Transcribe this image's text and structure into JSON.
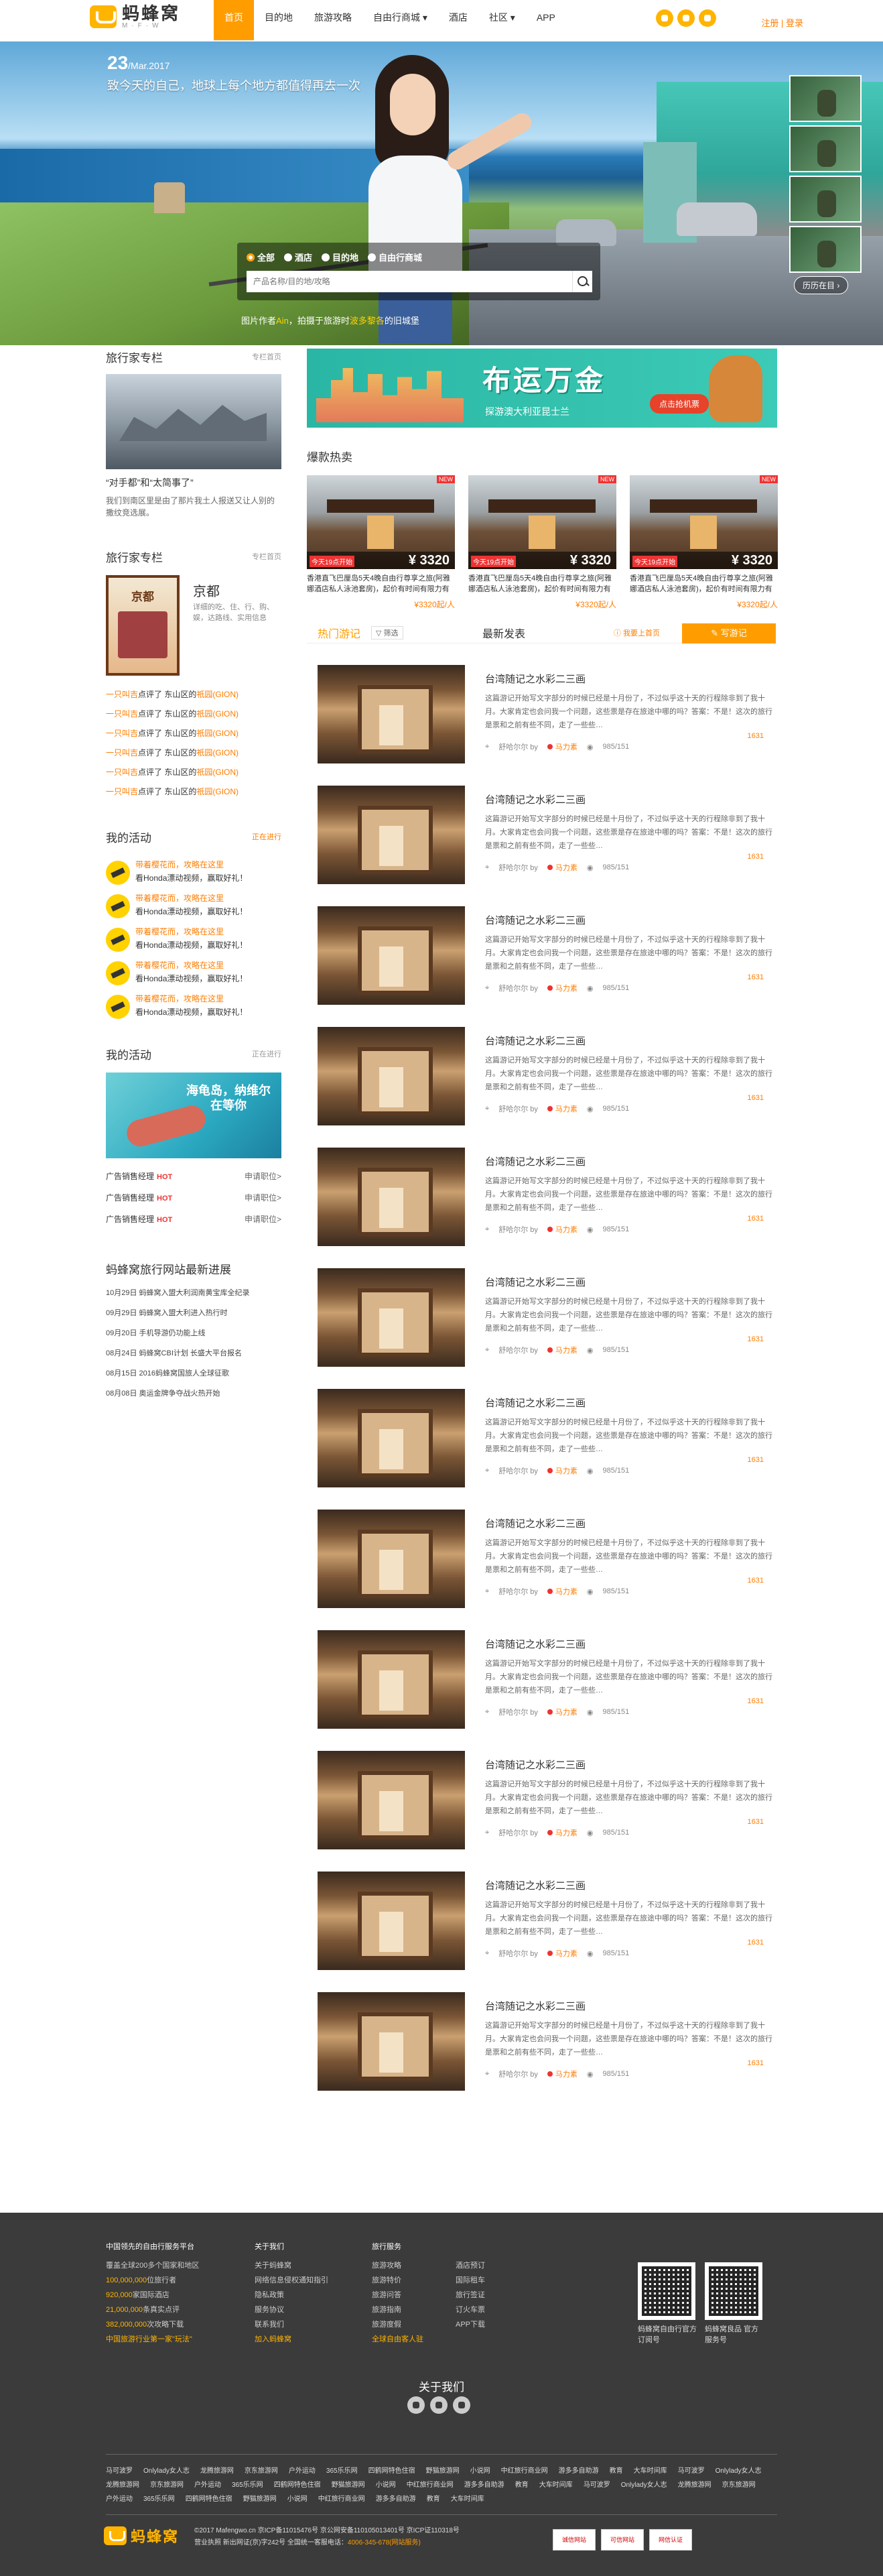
{
  "nav": {
    "logo": "蚂蜂窝",
    "logo_sub": "M·F·W",
    "items": [
      "首页",
      "目的地",
      "旅游攻略",
      "自由行商城 ▾",
      "酒店",
      "社区 ▾",
      "APP"
    ],
    "login": "注册 | 登录"
  },
  "hero": {
    "date_day": "23",
    "date_rest": "/Mar.2017",
    "tagline": "致今天的自己，地球上每个地方都值得再去一次",
    "radios": [
      "全部",
      "酒店",
      "目的地",
      "自由行商城"
    ],
    "search_placeholder": "产品名称/目的地/攻略",
    "history": "历历在目 ›",
    "caption_prefix": "图片作者",
    "caption_author": "Ain",
    "caption_mid": "，拍摄于旅游时",
    "caption_place": "波多黎各",
    "caption_suffix": "的旧城堡"
  },
  "left": {
    "column1": {
      "title": "旅行家专栏",
      "more": "专栏首页",
      "article_title": "“对手都”和“太简事了”",
      "article_text": "我们到南区里是由了那片我土人报送又让人别的撒纹竞选展。"
    },
    "column2": {
      "title": "旅行家专栏",
      "more": "专栏首页",
      "book_cover": "京都",
      "book_name": "京都",
      "book_desc": "详细的吃、住、行、购、娱，达路线、实用信息"
    },
    "feed": [
      {
        "user": "一只叫吉",
        "action": "点评了 东山区的",
        "place": "祇园(GION)"
      },
      {
        "user": "一只叫吉",
        "action": "点评了 东山区的",
        "place": "祇园(GION)"
      },
      {
        "user": "一只叫吉",
        "action": "点评了 东山区的",
        "place": "祇园(GION)"
      },
      {
        "user": "一只叫吉",
        "action": "点评了 东山区的",
        "place": "祇园(GION)"
      },
      {
        "user": "一只叫吉",
        "action": "点评了 东山区的",
        "place": "祇园(GION)"
      },
      {
        "user": "一只叫吉",
        "action": "点评了 东山区的",
        "place": "祇园(GION)"
      }
    ],
    "activities": {
      "title": "我的活动",
      "more": "正在进行",
      "items": [
        {
          "t1": "带着樱花而，攻略在这里",
          "t2": "看Honda漂动视频，赢取好礼！"
        },
        {
          "t1": "带着樱花而，攻略在这里",
          "t2": "看Honda漂动视频，赢取好礼！"
        },
        {
          "t1": "带着樱花而，攻略在这里",
          "t2": "看Honda漂动视频，赢取好礼！"
        },
        {
          "t1": "带着樱花而，攻略在这里",
          "t2": "看Honda漂动视频，赢取好礼！"
        },
        {
          "t1": "带着樱花而，攻略在这里",
          "t2": "看Honda漂动视频，赢取好礼！"
        }
      ]
    },
    "activities2": {
      "title": "我的活动",
      "more": "正在进行",
      "ad_line1": "海龟岛，纳维尔",
      "ad_line2": "在等你"
    },
    "jobs": [
      {
        "title": "广告销售经理",
        "hot": "HOT",
        "apply": "申请职位>"
      },
      {
        "title": "广告销售经理",
        "hot": "HOT",
        "apply": "申请职位>"
      },
      {
        "title": "广告销售经理",
        "hot": "HOT",
        "apply": "申请职位>"
      }
    ],
    "news": {
      "title": "蚂蜂窝旅行网站最新进展",
      "items": [
        {
          "date": "10月29日",
          "text": "蚂蜂窝入盟大利润南黄宝库全纪录"
        },
        {
          "date": "09月29日",
          "text": "蚂蜂窝入盟大利进入热行时"
        },
        {
          "date": "09月20日",
          "text": "手机导游仍功能上线"
        },
        {
          "date": "08月24日",
          "text": "蚂蜂窝CBI计划 长盛大平台报名"
        },
        {
          "date": "08月15日",
          "text": "2016蚂蜂窝国旅人全球征歌"
        },
        {
          "date": "08月08日",
          "text": "奥运金牌争夺战火热开始"
        }
      ]
    }
  },
  "right": {
    "banner": {
      "title": "布运万金",
      "sub": "探游澳大利亚昆士兰",
      "btn": "点击抢机票"
    },
    "hot_title": "爆款热卖",
    "hot_items": [
      {
        "tag": "NEW",
        "label": "今天19点开始",
        "price": "¥ 3320",
        "desc": "香港直飞巴厘岛5天4晚自由行尊享之旅(阿雅娜酒店私人泳池套房)，起价有时间有限力有",
        "sold": "¥3320起/人"
      },
      {
        "tag": "NEW",
        "label": "今天19点开始",
        "price": "¥ 3320",
        "desc": "香港直飞巴厘岛5天4晚自由行尊享之旅(阿雅娜酒店私人泳池套房)，起价有时间有限力有",
        "sold": "¥3320起/人"
      },
      {
        "tag": "NEW",
        "label": "今天19点开始",
        "price": "¥ 3320",
        "desc": "香港直飞巴厘岛5天4晚自由行尊享之旅(阿雅娜酒店私人泳池套房)，起价有时间有限力有",
        "sold": "¥3320起/人"
      }
    ],
    "tab_hot": "热门游记",
    "tab_filter": "▽ 筛选",
    "tab_new": "最新发表",
    "tab_upload": "ⓘ 我要上首页",
    "write_btn": "✎ 写游记",
    "post": {
      "title": "台湾随记之水彩二三画",
      "desc": "这篇游记开始写文字部分的时候已经是十月份了，不过似乎这十天的行程除非到了我十月。大家肯定也会问我一个问题，这些票是存在旅途中哪的吗？答案：不是！这次的旅行是票和之前有些不同，走了一些些…",
      "loc": "舒哈尔尔 by",
      "author": "马力素",
      "views": "985/151",
      "count": "1631"
    },
    "posts": [
      0,
      1,
      2,
      3,
      4,
      5,
      6,
      7,
      8,
      9,
      10,
      11
    ]
  },
  "footer": {
    "col1": {
      "hd": "中国领先的自由行服务平台",
      "l1": "覆盖全球200多个国家和地区",
      "l2_num": "100,000,000",
      "l2": "位旅行者",
      "l3_num": "920,000",
      "l3": "家国际酒店",
      "l4_num": "21,000,000",
      "l4": "条真实点评",
      "l5_num": "382,000,000",
      "l5": "次攻略下载",
      "l6": "中国旅游行业第一家\"玩法\""
    },
    "col2": {
      "hd": "关于我们",
      "items": [
        "关于蚂蜂窝",
        "网络信息侵权通知指引",
        "隐私政策",
        "服务协议",
        "联系我们"
      ],
      "y": "加入蚂蜂窝"
    },
    "col3": {
      "hd": "旅行服务",
      "items": [
        "旅游攻略",
        "旅游特价",
        "旅游问答",
        "旅游指南",
        "旅游度假"
      ],
      "y": "全球自由客人驻"
    },
    "col4": {
      "items": [
        "酒店预订",
        "国际租车",
        "旅行签证",
        "订火车票",
        "APP下载"
      ]
    },
    "qr1": "蚂蜂窝自由行官方订阅号",
    "qr2": "蚂蜂窝良品 官方服务号",
    "about": "关于我们",
    "links": [
      "马可波罗",
      "Onlylady女人志",
      "龙腾旅游网",
      "京东旅游网",
      "户外运动",
      "365乐乐网",
      "四鹤网特色住宿",
      "野猫旅游网",
      "小说网",
      "中红旅行商业网",
      "游多多自助游",
      "教育",
      "大车时间库",
      "马可波罗",
      "Onlylady女人志",
      "龙腾旅游网",
      "京东旅游网",
      "户外运动",
      "365乐乐网",
      "四鹤网特色住宿",
      "野猫旅游网",
      "小说网",
      "中红旅行商业网",
      "游多多自助游",
      "教育",
      "大车时间库",
      "马可波罗",
      "Onlylady女人志",
      "龙腾旅游网",
      "京东旅游网",
      "户外运动",
      "365乐乐网",
      "四鹤网特色住宿",
      "野猫旅游网",
      "小说网",
      "中红旅行商业网",
      "游多多自助游",
      "教育",
      "大车时间库"
    ],
    "logo": "蚂蜂窝",
    "copy1": "©2017 Mafengwo.cn 京ICP备11015476号 京公网安备110105013401号 京ICP证110318号",
    "copy2": "营业执照 新出网证(京)字242号 全国统一客服电话：",
    "phone": "4006-345-678(网站服务)",
    "badges": [
      "诚信网站",
      "可信网站",
      "网信认证"
    ]
  }
}
